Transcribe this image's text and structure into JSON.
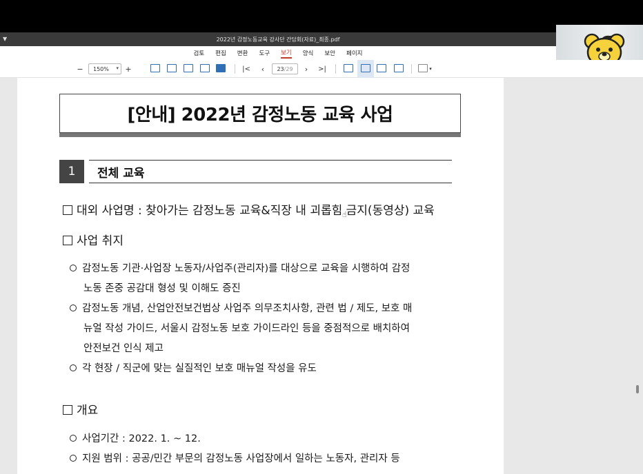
{
  "window": {
    "title": "2022년 감정노동교육 강사단 간담회(자료)_최종.pdf"
  },
  "menu": {
    "items": [
      "검토",
      "편집",
      "변환",
      "도구",
      "보기",
      "양식",
      "보안",
      "페이지"
    ],
    "active_index": 4
  },
  "toolbar": {
    "zoom": "150%",
    "page_current": "23",
    "page_total": "/29"
  },
  "document": {
    "title": "[안내] 2022년 감정노동 교육 사업",
    "section_number": "1",
    "section_title": "전체 교육",
    "item1": "대외 사업명 : 찾아가는 감정노동 교육&직장 내 괴롭힘 금지(동영상) 교육",
    "item2": "사업 취지",
    "bullets": [
      "감정노동 기관·사업장 노동자/사업주(관리자)를 대상으로 교육을 시행하여 감정",
      "노동 존중 공감대 형성 및 이해도 증진",
      "감정노동 개념, 산업안전보건법상 사업주 의무조치사항, 관련 법 / 제도, 보호 매",
      "뉴얼 작성 가이드, 서울시 감정노동 보호 가이드라인 등을 중점적으로 배치하여",
      "안전보건 인식 제고",
      "각 현장 / 직군에 맞는 실질적인 보호 매뉴얼 작성을 유도"
    ],
    "item3": "개요",
    "overview": [
      "사업기간 : 2022. 1. ~ 12.",
      "지원 범위 : 공공/민간 부문의 감정노동 사업장에서 일하는 노동자, 관리자 등"
    ]
  }
}
